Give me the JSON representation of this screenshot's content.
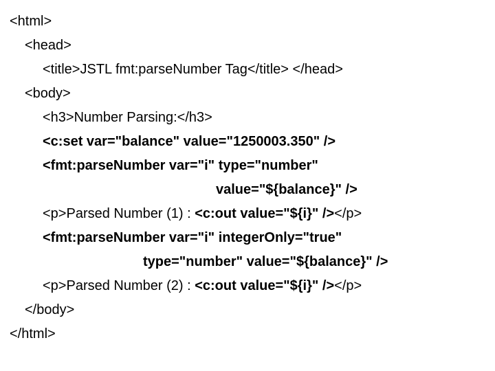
{
  "code": {
    "l1": "<html>",
    "l2": "<head>",
    "l3a": "<title>",
    "l3b": "JSTL fmt:parseNumber Tag",
    "l3c": "</title> </head>",
    "l4": "<body>",
    "l5a": "<h3>",
    "l5b": "Number Parsing:",
    "l5c": "</h3>",
    "l6": "<c:set var=\"balance\" value=\"1250003.350\" />",
    "l7": "<fmt:parseNumber var=\"i\" type=\"number\"",
    "l8": "value=\"${balance}\" />",
    "l9a": "<p>",
    "l9b": "Parsed Number (1) : ",
    "l9c": "<c:out value=\"${i}\" />",
    "l9d": "</p>",
    "l10": "<fmt:parseNumber var=\"i\" integerOnly=\"true\"",
    "l11": "type=\"number\" value=\"${balance}\" />",
    "l12a": "<p>",
    "l12b": "Parsed Number (2) : ",
    "l12c": "<c:out value=\"${i}\" />",
    "l12d": "</p>",
    "l13": "</body>",
    "l14": "</html>"
  }
}
